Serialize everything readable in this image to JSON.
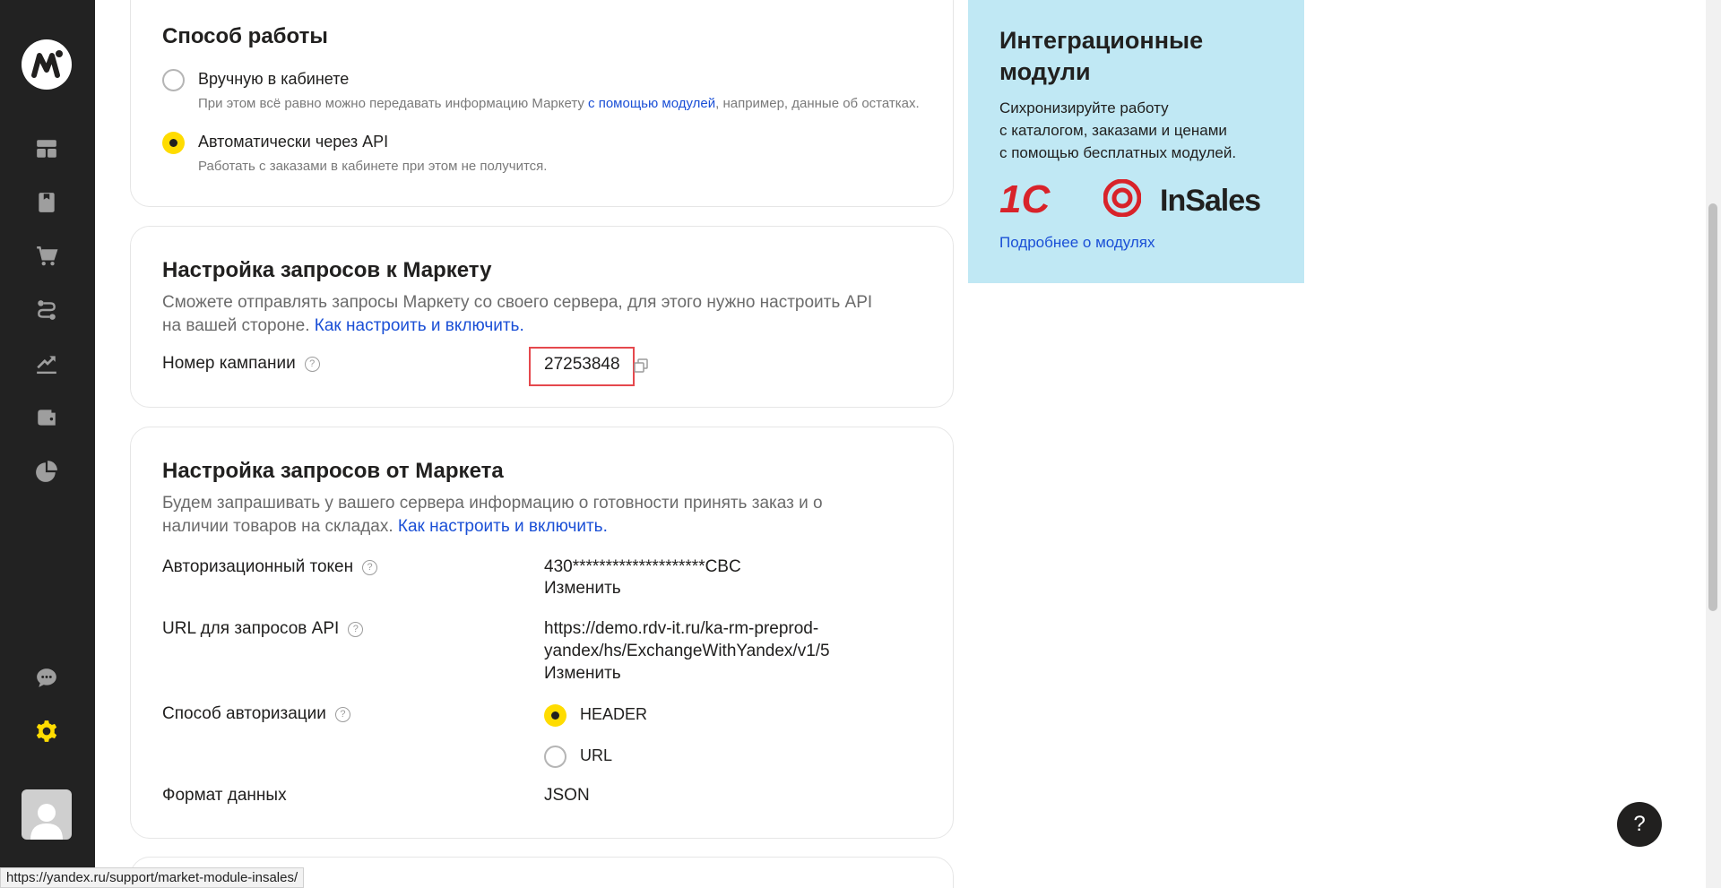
{
  "colors": {
    "accent": "#ffdc00",
    "link": "#1a4fd6",
    "sidebar": "#222222",
    "promo_bg": "#c0e8f4"
  },
  "sidebar": {
    "items": [
      {
        "icon": "dashboard-icon"
      },
      {
        "icon": "catalog-icon"
      },
      {
        "icon": "cart-icon"
      },
      {
        "icon": "logistics-icon"
      },
      {
        "icon": "growth-icon"
      },
      {
        "icon": "wallet-icon"
      },
      {
        "icon": "analytics-icon"
      },
      {
        "icon": "chat-icon"
      },
      {
        "icon": "settings-icon"
      }
    ]
  },
  "work_mode": {
    "title": "Способ работы",
    "options": [
      {
        "label": "Вручную в кабинете",
        "hint_before": "При этом всё равно можно передавать информацию Маркету ",
        "hint_link": "с помощью модулей",
        "hint_after": ", например, данные об остатках.",
        "checked": false
      },
      {
        "label": "Автоматически через API",
        "hint": "Работать с заказами в кабинете при этом не получится.",
        "checked": true
      }
    ]
  },
  "to_market": {
    "title": "Настройка запросов к Маркету",
    "desc_line1": "Сможете отправлять запросы Маркету со своего сервера, для этого нужно настроить API",
    "desc_line2": "на вашей стороне. ",
    "link": "Как настроить и включить.",
    "campaign_label": "Номер кампании",
    "campaign_value": "27253848"
  },
  "from_market": {
    "title": "Настройка запросов от Маркета",
    "desc_line1": "Будем запрашивать у вашего сервера информацию о готовности принять заказ и о",
    "desc_line2": "наличии товаров на складах. ",
    "link": "Как настроить и включить.",
    "token_label": "Авторизационный токен",
    "token_value": "430********************CBC",
    "change_label": "Изменить",
    "url_label": "URL для запросов API",
    "url_line1": "https://demo.rdv-it.ru/ka-rm-preprod-",
    "url_line2": "yandex/hs/ExchangeWithYandex/v1/5",
    "auth_label": "Способ авторизации",
    "auth_options": [
      {
        "label": "HEADER",
        "checked": true
      },
      {
        "label": "URL",
        "checked": false
      }
    ],
    "format_label": "Формат данных",
    "format_value": "JSON"
  },
  "promo": {
    "title_line1": "Интеграционные",
    "title_line2": "модули",
    "text_line1": "Сихронизируйте работу",
    "text_line2": "с каталогом, заказами и ценами",
    "text_line3": "с помощью бесплатных модулей.",
    "logo_1c": "1С",
    "logo_insales": "InSales",
    "link": "Подробнее о модулях"
  },
  "help_button": "?",
  "status_url": "https://yandex.ru/support/market-module-insales/"
}
